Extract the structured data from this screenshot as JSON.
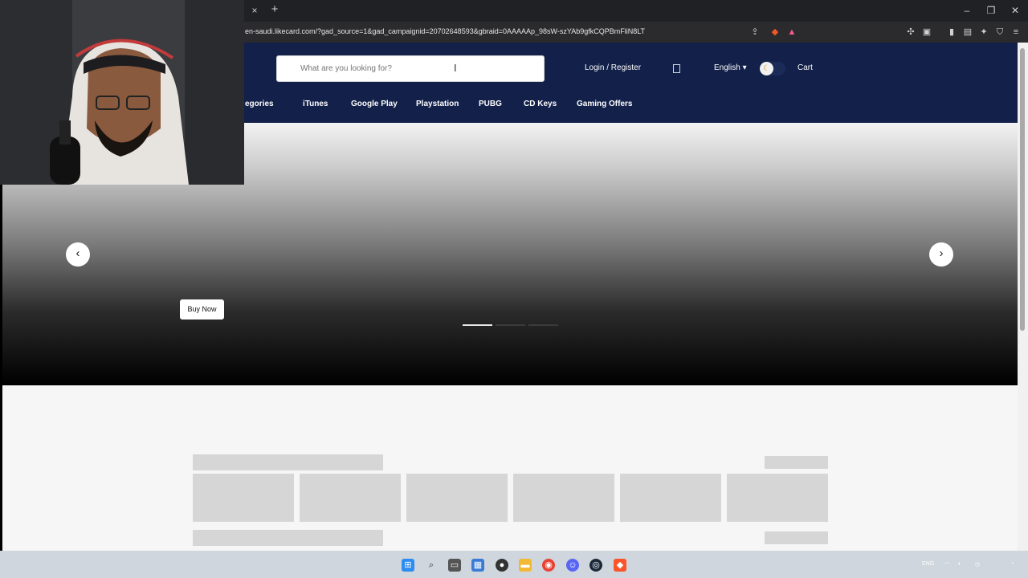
{
  "browser": {
    "url": "en-saudi.likecard.com/?gad_source=1&gad_campaignid=20702648593&gbraid=0AAAAAp_98sW-szYAb9gfkCQPBmFliN8LT",
    "tab_close": "×",
    "new_tab": "+",
    "minimize": "–",
    "restore": "❐",
    "close": "✕"
  },
  "header": {
    "search_placeholder": "What are you looking for?",
    "login_register": "Login / Register",
    "language": "English ▾",
    "cart": "Cart",
    "theme_icon": "moon-icon"
  },
  "nav": {
    "items": [
      {
        "label": "egories"
      },
      {
        "label": "iTunes"
      },
      {
        "label": "Google Play"
      },
      {
        "label": "Playstation"
      },
      {
        "label": "PUBG"
      },
      {
        "label": "CD Keys"
      },
      {
        "label": "Gaming Offers"
      }
    ]
  },
  "hero": {
    "prev": "‹",
    "next": "›",
    "buy_now": "Buy Now",
    "slides": 3,
    "active_slide": 1
  },
  "colors": {
    "header_bg": "#12204a",
    "page_bg": "#f6f6f6",
    "skeleton": "#d6d6d6"
  }
}
